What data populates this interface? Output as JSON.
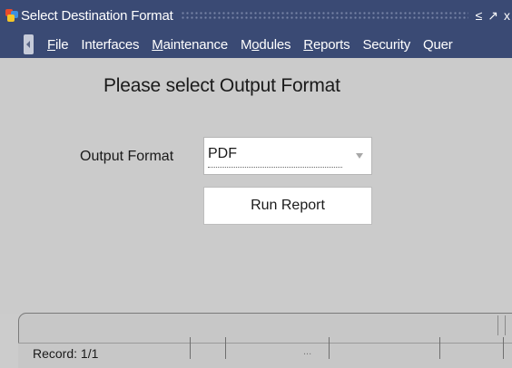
{
  "window": {
    "title": "Select Destination Format",
    "controls": {
      "minimize": "≤",
      "maximize": "↗",
      "close": "x"
    }
  },
  "menu": {
    "items": [
      {
        "label": "File",
        "underline_index": 0
      },
      {
        "label": "Interfaces",
        "underline_index": null
      },
      {
        "label": "Maintenance",
        "underline_index": 0
      },
      {
        "label": "Modules",
        "underline_index": 1
      },
      {
        "label": "Reports",
        "underline_index": 0
      },
      {
        "label": "Security",
        "underline_index": null
      },
      {
        "label": "Quer",
        "underline_index": null
      }
    ]
  },
  "form": {
    "heading": "Please select Output Format",
    "output_format_label": "Output Format",
    "output_format_value": "PDF",
    "run_button_label": "Run Report"
  },
  "status": {
    "record": "Record: 1/1",
    "ellipsis": "..."
  },
  "colors": {
    "titlebar": "#3a4a74",
    "content_bg": "#cbcbcb",
    "status_bg": "#c7c7c7"
  }
}
